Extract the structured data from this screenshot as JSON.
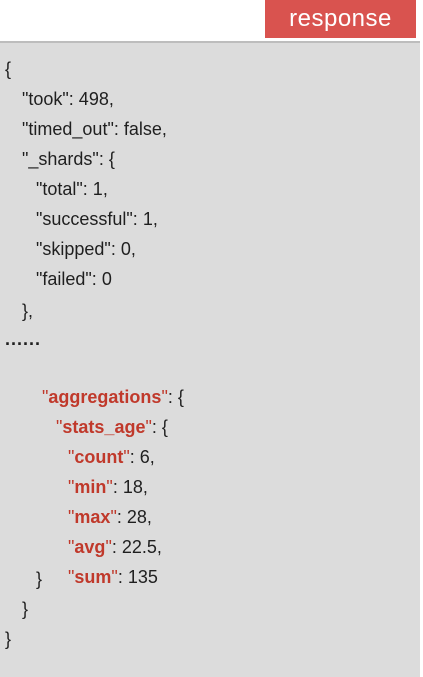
{
  "header": {
    "label": "response"
  },
  "code": {
    "open_brace": "{",
    "took": "\"took\": 498,",
    "timed_out": "\"timed_out\": false,",
    "shards_open": "\"_shards\": {",
    "total": "\"total\": 1,",
    "successful": "\"successful\": 1,",
    "skipped": "\"skipped\": 0,",
    "failed": "\"failed\": 0",
    "shards_close": "},",
    "ellipsis": "......",
    "aggregations_key": "aggregations",
    "aggregations_rest": ": {",
    "stats_age_key": "stats_age",
    "stats_age_rest": ": {",
    "count_key": "count",
    "count_rest": ": 6,",
    "min_key": "min",
    "min_rest": ": 18,",
    "max_key": "max",
    "max_rest": ": 28,",
    "avg_key": "avg",
    "avg_rest": ": 22.5,",
    "sum_key": "sum",
    "sum_rest": ": 135",
    "close_stats": "}",
    "close_aggs": "}",
    "close_root": "}"
  },
  "colors": {
    "accent": "#d9534f",
    "key_highlight": "#c0392b",
    "panel_bg": "#dcdcdc",
    "text": "#1f1f1f"
  }
}
